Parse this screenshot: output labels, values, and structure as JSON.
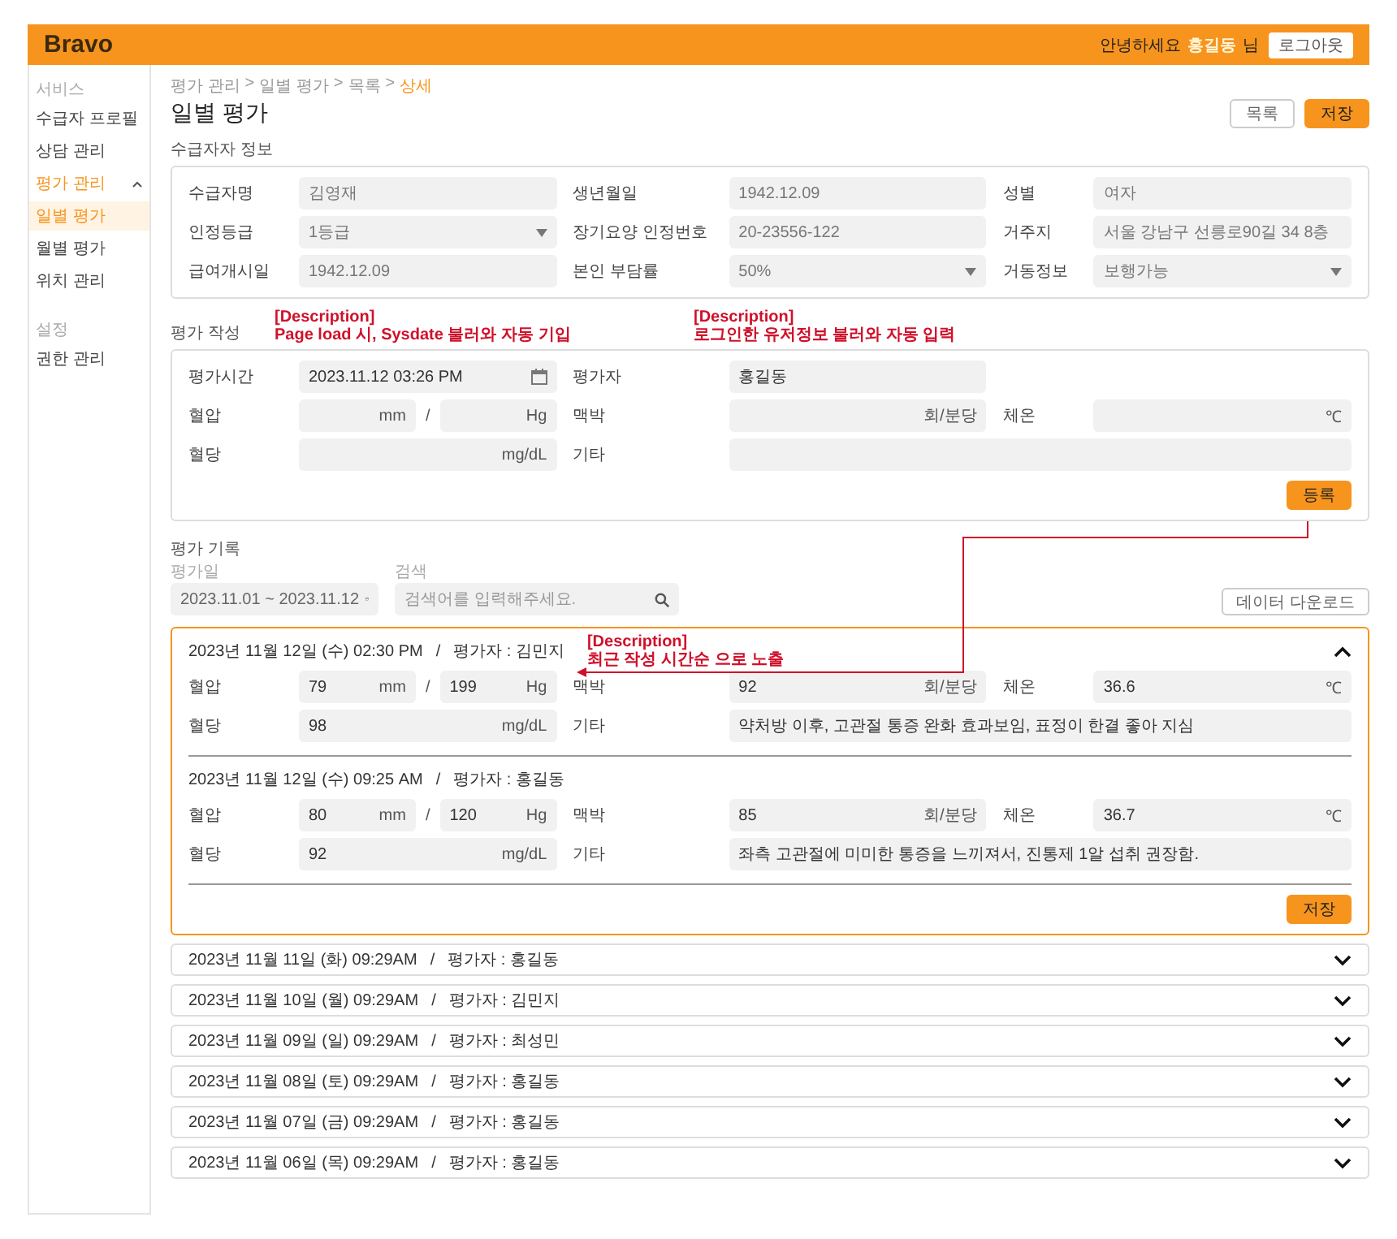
{
  "header": {
    "logo": "Bravo",
    "greeting": "안녕하세요",
    "user": "홍길동",
    "suffix": "님",
    "logout": "로그아웃"
  },
  "sidebar": {
    "groups": [
      {
        "label": "서비스",
        "items": [
          {
            "label": "수급자 프로필",
            "selected": false
          },
          {
            "label": "상담 관리",
            "selected": false
          },
          {
            "label": "평가 관리",
            "selected": false,
            "expanded": true,
            "children": [
              {
                "label": "일별 평가",
                "selected": true
              },
              {
                "label": "월별 평가",
                "selected": false
              }
            ]
          },
          {
            "label": "위치 관리",
            "selected": false
          }
        ]
      },
      {
        "label": "설정",
        "items": [
          {
            "label": "권한 관리",
            "selected": false
          }
        ]
      }
    ]
  },
  "breadcrumb": {
    "separator": ">",
    "items": [
      {
        "label": "평가 관리",
        "selected": false
      },
      {
        "label": "일별 평가",
        "selected": false
      },
      {
        "label": "목록",
        "selected": false
      },
      {
        "label": "상세",
        "selected": true
      }
    ]
  },
  "page_title": "일별 평가",
  "actions": [
    {
      "label": "목록",
      "kind": "outline"
    },
    {
      "label": "저장",
      "kind": "primary"
    }
  ],
  "recipient_info": {
    "title": "수급자자 정보",
    "rows": [
      [
        {
          "kind": "text",
          "label": "수급자명",
          "value": "김영재"
        },
        {
          "kind": "text",
          "label": "생년월일",
          "value": "1942.12.09"
        },
        {
          "kind": "text",
          "label": "성별",
          "value": "여자"
        }
      ],
      [
        {
          "kind": "select",
          "label": "인정등급",
          "value": "1등급"
        },
        {
          "kind": "text",
          "label": "장기요양 인정번호",
          "value": "20-23556-122"
        },
        {
          "kind": "text",
          "label": "거주지",
          "value": "서울 강남구 선릉로90길 34 8층"
        }
      ],
      [
        {
          "kind": "text",
          "label": "급여개시일",
          "value": "1942.12.09"
        },
        {
          "kind": "select",
          "label": "본인 부담률",
          "value": "50%"
        },
        {
          "kind": "select",
          "label": "거동정보",
          "value": "보행가능"
        }
      ]
    ]
  },
  "evaluation_form": {
    "title": "평가 작성",
    "notes": [
      {
        "heading": "[Description]",
        "text": "Page load 시, Sysdate 불러와 자동 기입"
      },
      {
        "heading": "[Description]",
        "text": "로그인한 유저정보 불러와 자동 입력"
      }
    ],
    "rows": [
      [
        {
          "kind": "date",
          "label": "평가시간",
          "value": "2023.11.12 03:26 PM"
        },
        {
          "kind": "text",
          "label": "평가자",
          "value": "홍길동"
        }
      ],
      [
        {
          "kind": "bp",
          "label": "혈압",
          "units": [
            "mm",
            "Hg"
          ],
          "separator": "/"
        },
        {
          "kind": "unit",
          "label": "맥박",
          "unit": "회/분당"
        },
        {
          "kind": "unit",
          "label": "체온",
          "unit": "℃"
        }
      ],
      [
        {
          "kind": "unit",
          "label": "혈당",
          "unit": "mg/dL"
        },
        {
          "kind": "note",
          "label": "기타"
        }
      ]
    ],
    "submit": "등록"
  },
  "records": {
    "title": "평가 기록",
    "date_filter": {
      "label": "평가일",
      "value": "2023.11.01 ~ 2023.11.12"
    },
    "search": {
      "label": "검색",
      "placeholder": "검색어를 입력해주세요."
    },
    "download": "데이터 다운로드",
    "separator": "/",
    "note": {
      "heading": "[Description]",
      "text": "최근 작성 시간순 으로 노출"
    },
    "items": [
      {
        "expanded": true,
        "save": "저장",
        "entries": [
          {
            "datetime": "2023년 11월 12일 (수) 02:30 PM",
            "evaluator": "평가자 : 김민지",
            "rows": [
              [
                {
                  "kind": "bp",
                  "label": "혈압",
                  "values": [
                    "79",
                    "199"
                  ],
                  "units": [
                    "mm",
                    "Hg"
                  ],
                  "separator": "/"
                },
                {
                  "kind": "unit",
                  "label": "맥박",
                  "value": "92",
                  "unit": "회/분당"
                },
                {
                  "kind": "unit",
                  "label": "체온",
                  "value": "36.6",
                  "unit": "℃"
                }
              ],
              [
                {
                  "kind": "unit",
                  "label": "혈당",
                  "value": "98",
                  "unit": "mg/dL"
                },
                {
                  "kind": "note",
                  "label": "기타",
                  "value": "약처방 이후, 고관절 통증 완화 효과보임, 표정이 한결 좋아 지심"
                }
              ]
            ]
          },
          {
            "datetime": "2023년 11월 12일 (수) 09:25 AM",
            "evaluator": "평가자 : 홍길동",
            "rows": [
              [
                {
                  "kind": "bp",
                  "label": "혈압",
                  "values": [
                    "80",
                    "120"
                  ],
                  "units": [
                    "mm",
                    "Hg"
                  ],
                  "separator": "/"
                },
                {
                  "kind": "unit",
                  "label": "맥박",
                  "value": "85",
                  "unit": "회/분당"
                },
                {
                  "kind": "unit",
                  "label": "체온",
                  "value": "36.7",
                  "unit": "℃"
                }
              ],
              [
                {
                  "kind": "unit",
                  "label": "혈당",
                  "value": "92",
                  "unit": "mg/dL"
                },
                {
                  "kind": "note",
                  "label": "기타",
                  "value": "좌측 고관절에 미미한 통증을 느끼져서, 진통제 1알 섭취 권장함."
                }
              ]
            ]
          }
        ]
      },
      {
        "expanded": false,
        "entries": [
          {
            "datetime": "2023년 11월 11일 (화) 09:29AM",
            "evaluator": "평가자 : 홍길동"
          }
        ]
      },
      {
        "expanded": false,
        "entries": [
          {
            "datetime": "2023년 11월 10일 (월) 09:29AM",
            "evaluator": "평가자 : 김민지"
          }
        ]
      },
      {
        "expanded": false,
        "entries": [
          {
            "datetime": "2023년 11월 09일 (일) 09:29AM",
            "evaluator": "평가자 : 최성민"
          }
        ]
      },
      {
        "expanded": false,
        "entries": [
          {
            "datetime": "2023년 11월 08일 (토) 09:29AM",
            "evaluator": "평가자 : 홍길동"
          }
        ]
      },
      {
        "expanded": false,
        "entries": [
          {
            "datetime": "2023년 11월 07일 (금) 09:29AM",
            "evaluator": "평가자 : 홍길동"
          }
        ]
      },
      {
        "expanded": false,
        "entries": [
          {
            "datetime": "2023년 11월 06일 (목) 09:29AM",
            "evaluator": "평가자 : 홍길동"
          }
        ]
      }
    ]
  }
}
